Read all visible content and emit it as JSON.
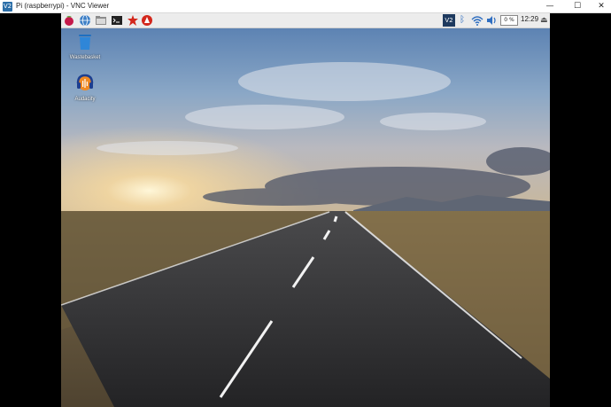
{
  "window": {
    "app_icon_text": "V2",
    "title": "Pi (raspberrypi) - VNC Viewer",
    "minimize_glyph": "—",
    "maximize_glyph": "☐",
    "close_glyph": "✕"
  },
  "taskbar": {
    "launchers": [
      {
        "icon": "raspberry-menu-icon"
      },
      {
        "icon": "web-browser-icon"
      },
      {
        "icon": "file-manager-icon"
      },
      {
        "icon": "terminal-icon"
      },
      {
        "icon": "mathematica-icon"
      },
      {
        "icon": "wolfram-icon"
      }
    ],
    "tray": {
      "vnc_text": "V2",
      "bluetooth_glyph": "ᛒ",
      "cpu": "0 %",
      "clock": "12:29",
      "eject_glyph": "⏏"
    }
  },
  "desktop": {
    "icons": [
      {
        "label": "Wastebasket",
        "icon": "wastebasket-icon"
      },
      {
        "label": "Audacity",
        "icon": "audacity-icon"
      }
    ]
  },
  "colors": {
    "taskbar_bg": "#ececec",
    "sky_top": "#5d83b3",
    "road": "#2d2d2f",
    "field": "#6e5d3e"
  }
}
